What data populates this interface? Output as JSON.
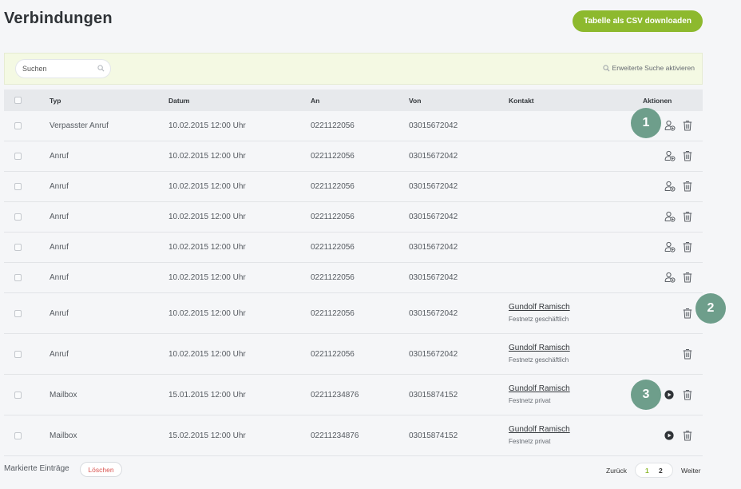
{
  "page": {
    "title": "Verbindungen"
  },
  "toolbar": {
    "csv_label": "Tabelle als CSV downloaden"
  },
  "search": {
    "placeholder": "Suchen",
    "advanced_label": "Erweiterte Suche aktivieren"
  },
  "table": {
    "headers": {
      "typ": "Typ",
      "datum": "Datum",
      "an": "An",
      "von": "Von",
      "kontakt": "Kontakt",
      "aktionen": "Aktionen"
    },
    "rows": [
      {
        "typ": "Verpasster Anruf",
        "datum": "10.02.2015 12:00 Uhr",
        "an": "0221122056",
        "von": "03015672042",
        "contact_name": "",
        "contact_sub": "",
        "actions": [
          "add-contact",
          "delete"
        ]
      },
      {
        "typ": "Anruf",
        "datum": "10.02.2015 12:00 Uhr",
        "an": "0221122056",
        "von": "03015672042",
        "contact_name": "",
        "contact_sub": "",
        "actions": [
          "add-contact",
          "delete"
        ]
      },
      {
        "typ": "Anruf",
        "datum": "10.02.2015 12:00 Uhr",
        "an": "0221122056",
        "von": "03015672042",
        "contact_name": "",
        "contact_sub": "",
        "actions": [
          "add-contact",
          "delete"
        ]
      },
      {
        "typ": "Anruf",
        "datum": "10.02.2015 12:00 Uhr",
        "an": "0221122056",
        "von": "03015672042",
        "contact_name": "",
        "contact_sub": "",
        "actions": [
          "add-contact",
          "delete"
        ]
      },
      {
        "typ": "Anruf",
        "datum": "10.02.2015 12:00 Uhr",
        "an": "0221122056",
        "von": "03015672042",
        "contact_name": "",
        "contact_sub": "",
        "actions": [
          "add-contact",
          "delete"
        ]
      },
      {
        "typ": "Anruf",
        "datum": "10.02.2015 12:00 Uhr",
        "an": "0221122056",
        "von": "03015672042",
        "contact_name": "",
        "contact_sub": "",
        "actions": [
          "add-contact",
          "delete"
        ]
      },
      {
        "typ": "Anruf",
        "datum": "10.02.2015 12:00 Uhr",
        "an": "0221122056",
        "von": "03015672042",
        "contact_name": "Gundolf Ramisch",
        "contact_sub": "Festnetz geschäftlich",
        "actions": [
          "delete"
        ]
      },
      {
        "typ": "Anruf",
        "datum": "10.02.2015 12:00 Uhr",
        "an": "0221122056",
        "von": "03015672042",
        "contact_name": "Gundolf Ramisch",
        "contact_sub": "Festnetz geschäftlich",
        "actions": [
          "delete"
        ]
      },
      {
        "typ": "Mailbox",
        "datum": "15.01.2015 12:00 Uhr",
        "an": "02211234876",
        "von": "03015874152",
        "contact_name": "Gundolf Ramisch",
        "contact_sub": "Festnetz privat",
        "actions": [
          "play",
          "delete"
        ]
      },
      {
        "typ": "Mailbox",
        "datum": "15.02.2015 12:00 Uhr",
        "an": "02211234876",
        "von": "03015874152",
        "contact_name": "Gundolf Ramisch",
        "contact_sub": "Festnetz privat",
        "actions": [
          "play",
          "delete"
        ]
      }
    ]
  },
  "callouts": [
    "1",
    "2",
    "3"
  ],
  "footer": {
    "marked_label": "Markierte Einträge",
    "delete_label": "Löschen",
    "pager": {
      "back_label": "Zurück",
      "pages": [
        "1",
        "2"
      ],
      "current": "1",
      "next_label": "Weiter"
    }
  },
  "colors": {
    "accent_green": "#8db92e",
    "callout_green": "#6e9e8b",
    "delete_red": "#d9534f",
    "search_bar_bg": "#f4f9e3"
  }
}
